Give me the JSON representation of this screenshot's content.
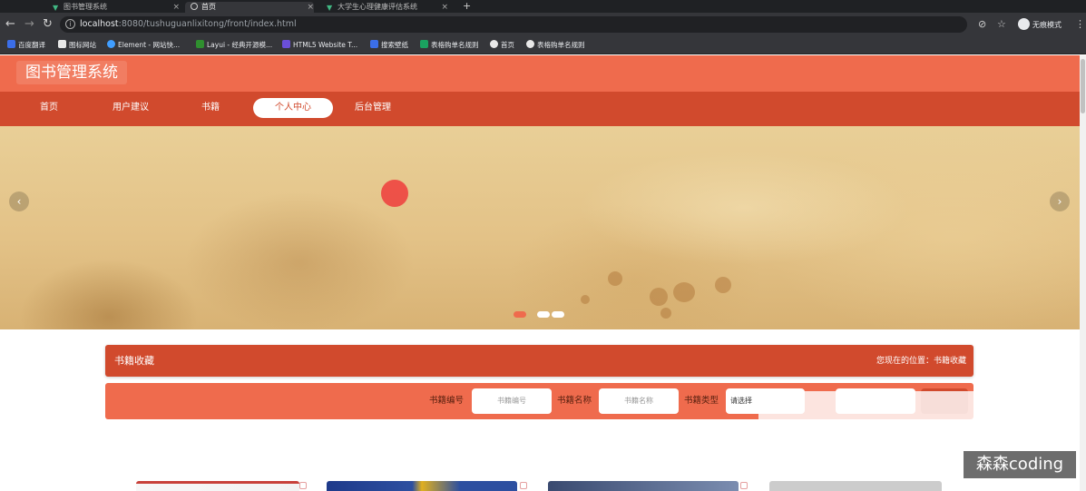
{
  "browser": {
    "tabs": [
      {
        "title": "图书管理系统",
        "favicon": "vue-icon"
      },
      {
        "title": "首页",
        "favicon": "globe-icon"
      },
      {
        "title": "大学生心理健康评估系统",
        "favicon": "vue-icon"
      }
    ],
    "url_host": "localhost",
    "url_rest": ":8080/tushuguanlixitong/front/index.html",
    "profile_label": "无痕模式",
    "bookmarks": [
      {
        "label": "百度翻译",
        "color": "#3b6ee8"
      },
      {
        "label": "图标网站",
        "color": "#e8e8e8"
      },
      {
        "label": "Element - 网站快...",
        "color": "#409eff"
      },
      {
        "label": "Layui - 经典开源模...",
        "color": "#2f8f2f"
      },
      {
        "label": "HTML5 Website T...",
        "color": "#6a4fd8"
      },
      {
        "label": "搜索壁纸",
        "color": "#3b6ee8"
      },
      {
        "label": "表格购单名规则",
        "color": "#1aa260"
      },
      {
        "label": "首页",
        "color": "#e8e8e8"
      },
      {
        "label": "表格购单名规则",
        "color": "#e8e8e8"
      }
    ]
  },
  "site": {
    "logo": "图书管理系统",
    "nav": [
      {
        "label": "首页",
        "active": false
      },
      {
        "label": "用户建议",
        "active": false
      },
      {
        "label": "书籍",
        "active": false
      },
      {
        "label": "个人中心",
        "active": true
      },
      {
        "label": "后台管理",
        "active": false
      }
    ],
    "banner": {
      "slides": 3,
      "active_slide": 1
    }
  },
  "breadcrumb": {
    "title": "书籍收藏",
    "location": "您现在的位置：书籍收藏"
  },
  "search": {
    "book_no_label": "书籍编号",
    "book_no_placeholder": "书籍编号",
    "book_name_label": "书籍名称",
    "book_name_placeholder": "书籍名称",
    "book_type_label": "书籍类型",
    "book_type_value": "请选择"
  },
  "watermark": "森森coding",
  "colors": {
    "header": "#ef6b4d",
    "nav": "#d14a2d"
  }
}
